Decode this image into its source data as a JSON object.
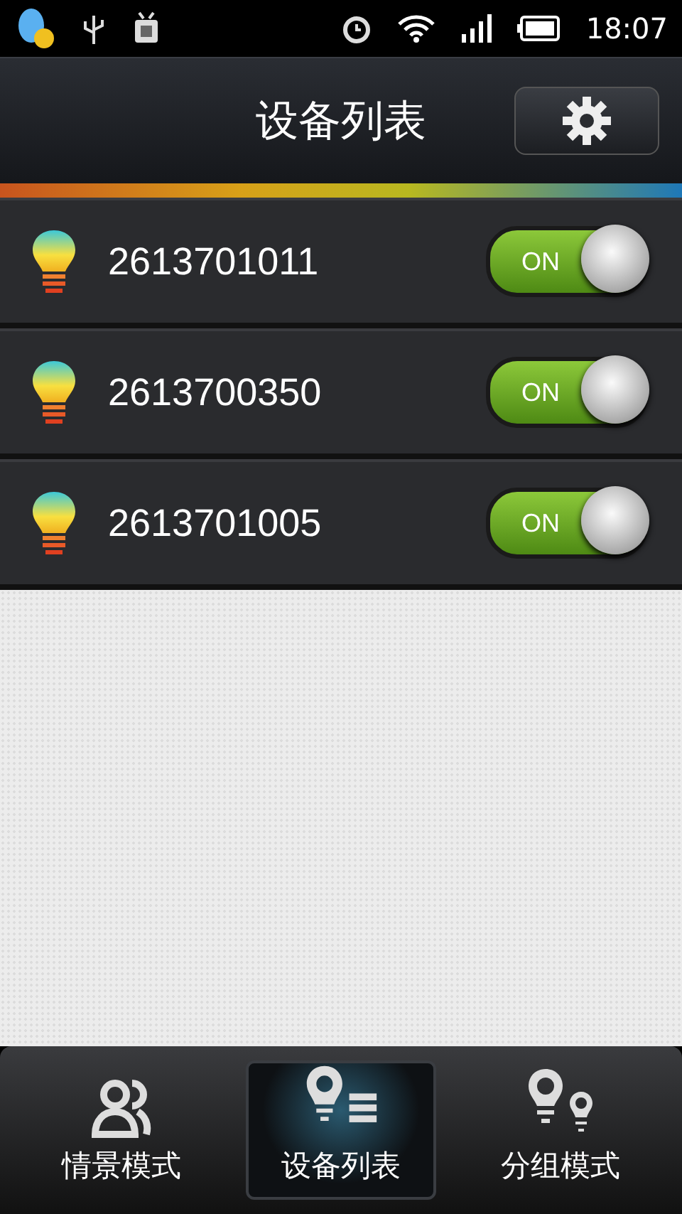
{
  "status_bar": {
    "time": "18:07"
  },
  "header": {
    "title": "设备列表"
  },
  "devices": [
    {
      "name": "2613701011",
      "on": true,
      "switch_label": "ON"
    },
    {
      "name": "2613700350",
      "on": true,
      "switch_label": "ON"
    },
    {
      "name": "2613701005",
      "on": true,
      "switch_label": "ON"
    }
  ],
  "tabs": [
    {
      "label": "情景模式",
      "kind": "scenes",
      "selected": false
    },
    {
      "label": "设备列表",
      "kind": "devices",
      "selected": true
    },
    {
      "label": "分组模式",
      "kind": "groups",
      "selected": false
    }
  ]
}
